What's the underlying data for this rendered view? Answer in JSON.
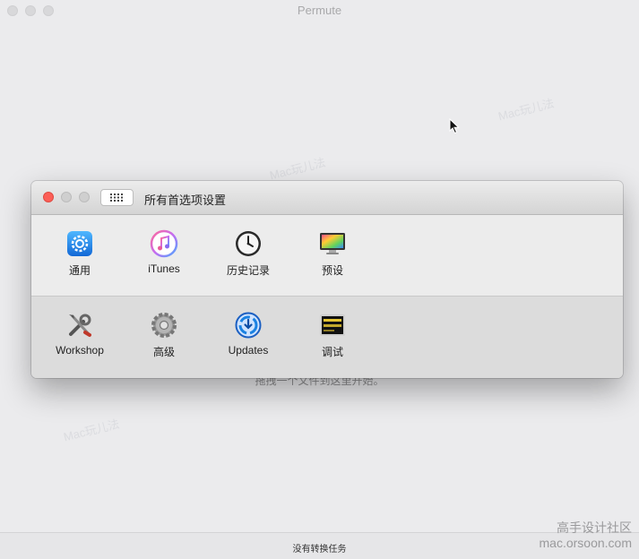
{
  "app": {
    "title": "Permute"
  },
  "main": {
    "drop_hint": "拖拽一个文件到这里开始。"
  },
  "statusbar": {
    "text": "没有转换任务"
  },
  "preferences": {
    "title": "所有首选项设置",
    "rows": [
      [
        {
          "label": "通用",
          "icon": "general-icon"
        },
        {
          "label": "iTunes",
          "icon": "itunes-icon"
        },
        {
          "label": "历史记录",
          "icon": "history-icon"
        },
        {
          "label": "预设",
          "icon": "presets-icon"
        }
      ],
      [
        {
          "label": "Workshop",
          "icon": "workshop-icon"
        },
        {
          "label": "高级",
          "icon": "advanced-icon"
        },
        {
          "label": "Updates",
          "icon": "updates-icon"
        },
        {
          "label": "调试",
          "icon": "debug-icon"
        }
      ]
    ]
  },
  "watermark": {
    "line1": "高手设计社区",
    "line2": "mac.orsoon.com",
    "faint": "Mac玩儿法"
  },
  "colors": {
    "close": "#fc5f57",
    "accent": "#1a82e2"
  }
}
